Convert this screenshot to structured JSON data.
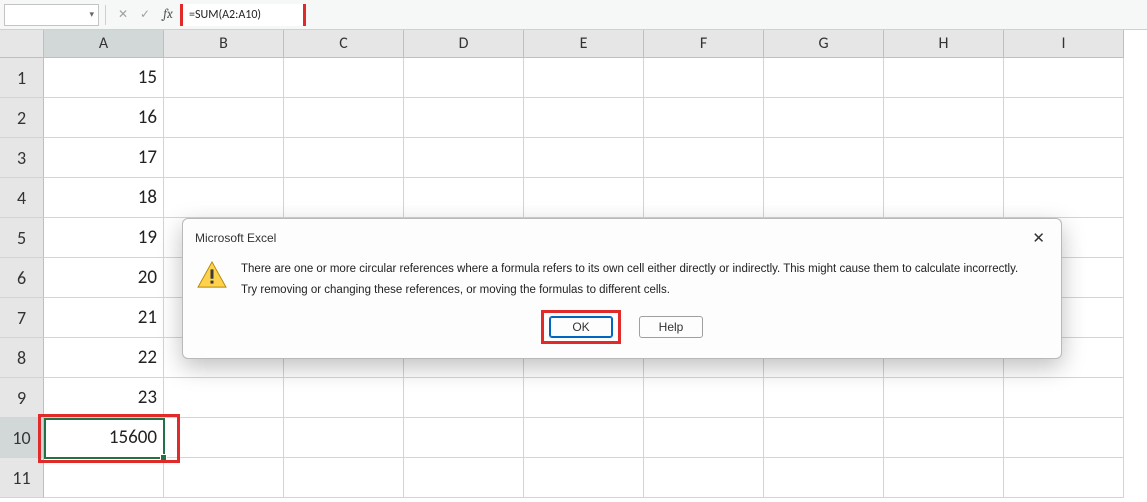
{
  "formula_bar": {
    "name_box_value": "",
    "fx_label": "fx",
    "formula_value": "=SUM(A2:A10)"
  },
  "columns": [
    "A",
    "B",
    "C",
    "D",
    "E",
    "F",
    "G",
    "H",
    "I"
  ],
  "rows": [
    1,
    2,
    3,
    4,
    5,
    6,
    7,
    8,
    9,
    10,
    11
  ],
  "cells": {
    "A1": "15",
    "A2": "16",
    "A3": "17",
    "A4": "18",
    "A5": "19",
    "A6": "20",
    "A7": "21",
    "A8": "22",
    "A9": "23",
    "A10": "15600"
  },
  "active_cell": {
    "row": 10,
    "col": "A"
  },
  "dialog": {
    "title": "Microsoft Excel",
    "line1": "There are one or more circular references where a formula refers to its own cell either directly or indirectly. This might cause them to calculate incorrectly.",
    "line2": "Try removing or changing these references, or moving the formulas to different cells.",
    "ok_label": "OK",
    "help_label": "Help"
  },
  "icons": {
    "cancel": "✕",
    "accept": "✓",
    "close": "✕",
    "dropdown": "▾"
  }
}
